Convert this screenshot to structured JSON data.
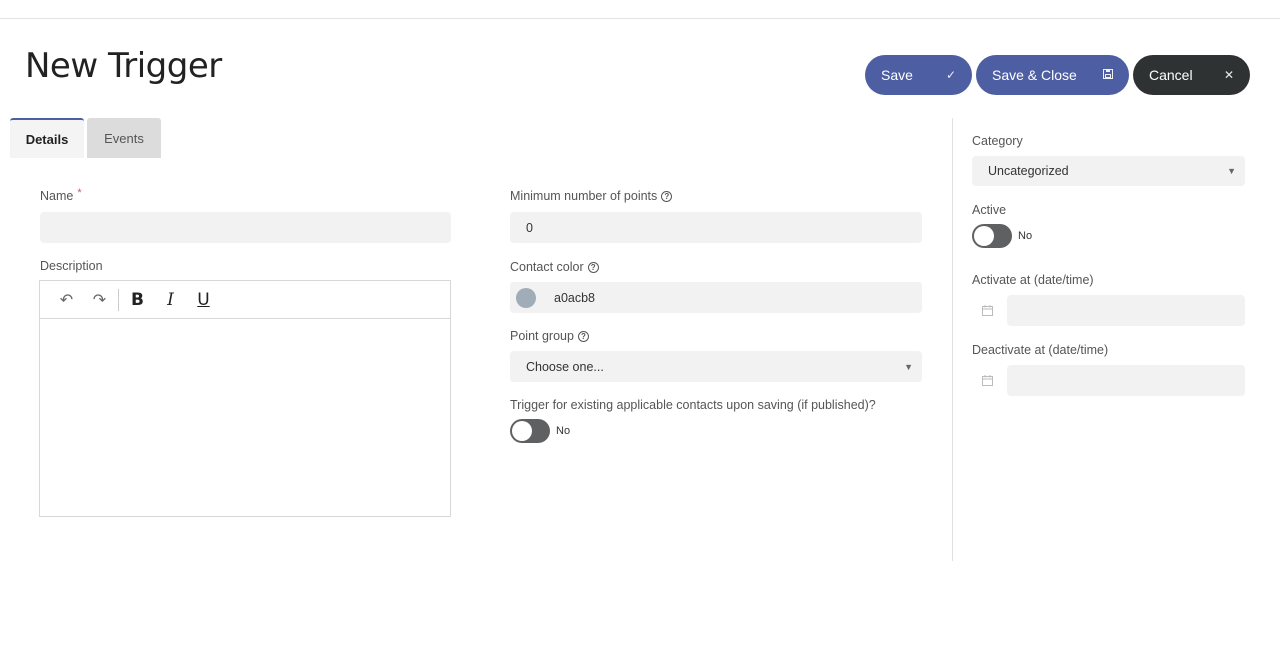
{
  "header": {
    "title": "New Trigger",
    "save_label": "Save",
    "save_icon": "check-icon",
    "save_close_label": "Save & Close",
    "save_close_icon": "save-icon",
    "cancel_label": "Cancel",
    "cancel_icon": "close-icon"
  },
  "tabs": [
    {
      "label": "Details",
      "active": true
    },
    {
      "label": "Events",
      "active": false
    }
  ],
  "details": {
    "name_label": "Name",
    "name_required_mark": "*",
    "name_value": "",
    "description_label": "Description",
    "editor_toolbar": [
      "undo",
      "redo",
      "B",
      "I",
      "U"
    ],
    "min_points_label": "Minimum number of points",
    "min_points_value": "0",
    "contact_color_label": "Contact color",
    "contact_color_value": "a0acb8",
    "contact_color_hex": "#a0acb8",
    "point_group_label": "Point group",
    "point_group_value": "Choose one...",
    "trigger_existing_label": "Trigger for existing applicable contacts upon saving (if published)?",
    "trigger_existing_value": "No"
  },
  "sidebar": {
    "category_label": "Category",
    "category_value": "Uncategorized",
    "active_label": "Active",
    "active_value": "No",
    "activate_at_label": "Activate at (date/time)",
    "activate_at_value": "",
    "deactivate_at_label": "Deactivate at (date/time)",
    "deactivate_at_value": ""
  },
  "colors": {
    "primary": "#4e5ea2",
    "cancel": "#2f3233",
    "toggle_off": "#5f6062"
  }
}
